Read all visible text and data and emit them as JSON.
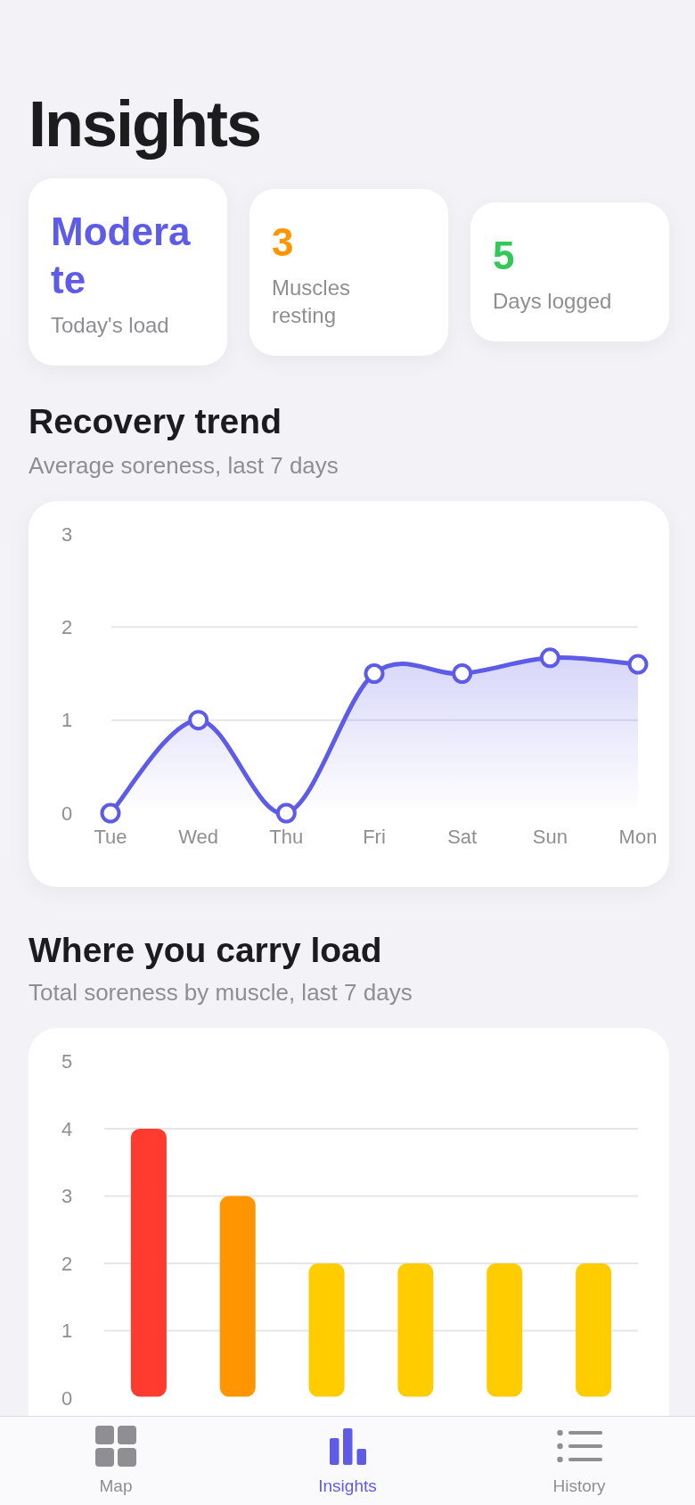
{
  "title": "Insights",
  "stats": [
    {
      "value": "Moderate",
      "label": "Today's load",
      "color": "#5e5ce6"
    },
    {
      "value": "3",
      "label": "Muscles resting",
      "color": "#ff9500"
    },
    {
      "value": "5",
      "label": "Days logged",
      "color": "#34c759"
    }
  ],
  "sections": [
    {
      "title": "Recovery trend",
      "subtitle": "Average soreness, last 7 days",
      "chart_data": {
        "type": "area",
        "categories": [
          "Tue",
          "Wed",
          "Thu",
          "Fri",
          "Sat",
          "Sun",
          "Mon"
        ],
        "values": [
          0,
          1,
          0,
          1.5,
          1.5,
          1.67,
          1.6
        ],
        "ylim": [
          0,
          3
        ],
        "yticks": [
          0,
          1,
          2,
          3
        ],
        "grid": true
      }
    },
    {
      "title": "Where you carry load",
      "subtitle": "Total soreness by muscle, last 7 days",
      "chart_data": {
        "type": "bar",
        "values": [
          4,
          3,
          2,
          2,
          2,
          2
        ],
        "ylim": [
          0,
          5
        ],
        "yticks": [
          0,
          1,
          2,
          3,
          4,
          5
        ],
        "grid": true
      }
    }
  ],
  "tab_bar": [
    {
      "label": "Map",
      "selected": false
    },
    {
      "label": "Insights",
      "selected": true
    },
    {
      "label": "History",
      "selected": false
    }
  ]
}
